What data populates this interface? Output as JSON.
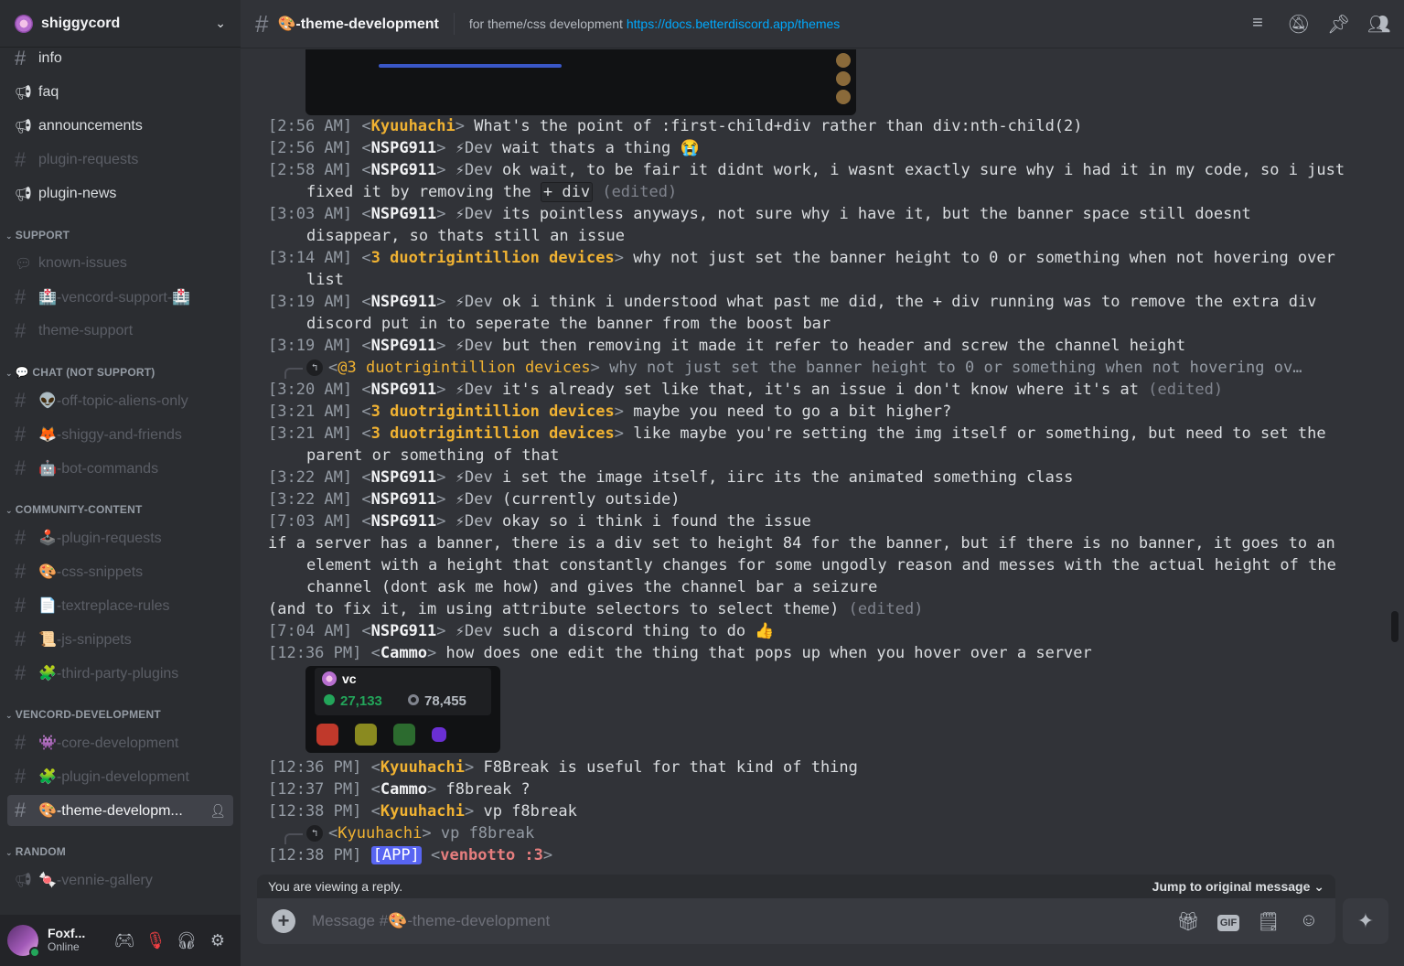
{
  "server": {
    "name": "shiggycord"
  },
  "channel_groups": {
    "top": [
      {
        "label": "info",
        "icon": "hash",
        "style": "bright"
      },
      {
        "label": "faq",
        "icon": "megaphone",
        "style": "bright"
      },
      {
        "label": "announcements",
        "icon": "megaphone",
        "style": "bright"
      },
      {
        "label": "plugin-requests",
        "icon": "hash",
        "style": "muted"
      },
      {
        "label": "plugin-news",
        "icon": "megaphone",
        "style": "bright"
      }
    ],
    "support_label": "SUPPORT",
    "support": [
      {
        "label": "known-issues",
        "icon": "forum",
        "style": "muted"
      },
      {
        "label": "🏥-vencord-support-🏥",
        "icon": "hash",
        "style": "muted"
      },
      {
        "label": "theme-support",
        "icon": "hash",
        "style": "muted"
      }
    ],
    "chat_label": "💬 CHAT (NOT SUPPORT)",
    "chat": [
      {
        "label": "👽-off-topic-aliens-only",
        "icon": "hash",
        "style": "muted"
      },
      {
        "label": "🦊-shiggy-and-friends",
        "icon": "hash",
        "style": "muted"
      },
      {
        "label": "🤖-bot-commands",
        "icon": "hash",
        "style": "muted"
      }
    ],
    "community_label": "COMMUNITY-CONTENT",
    "community": [
      {
        "label": "🕹️-plugin-requests",
        "icon": "hash",
        "style": "muted"
      },
      {
        "label": "🎨-css-snippets",
        "icon": "hash",
        "style": "muted"
      },
      {
        "label": "📄-textreplace-rules",
        "icon": "hash",
        "style": "muted"
      },
      {
        "label": "📜-js-snippets",
        "icon": "hash",
        "style": "muted"
      },
      {
        "label": "🧩-third-party-plugins",
        "icon": "hash",
        "style": "muted"
      }
    ],
    "vencord_label": "VENCORD-DEVELOPMENT",
    "vencord": [
      {
        "label": "👾-core-development",
        "icon": "hash",
        "style": "muted"
      },
      {
        "label": "🧩-plugin-development",
        "icon": "hash",
        "style": "muted"
      },
      {
        "label": "🎨-theme-developm...",
        "icon": "hash",
        "style": "active"
      }
    ],
    "random_label": "RANDOM",
    "random": [
      {
        "label": "🍬-vennie-gallery",
        "icon": "megaphone",
        "style": "muted"
      }
    ]
  },
  "user": {
    "name": "Foxf...",
    "status": "Online"
  },
  "header": {
    "channel": "🎨-theme-development",
    "topic": "for theme/css development",
    "topic_link": "https://docs.betterdiscord.app/themes"
  },
  "messages": [
    {
      "ts": "[2:56 AM]",
      "author": "Kyuuhachi",
      "color": "gold",
      "tag": "",
      "text": "What's the point of :first-child+div rather than div:nth-child(2)"
    },
    {
      "ts": "[2:56 AM]",
      "author": "NSPG911",
      "color": "white",
      "tag": "⚡Dev",
      "text": "wait thats a thing 😭"
    },
    {
      "ts": "[2:58 AM]",
      "author": "NSPG911",
      "color": "white",
      "tag": "⚡Dev",
      "text": "ok wait, to be fair it didnt work, i wasnt exactly sure why i had it in my code, so i just fixed it by removing the",
      "code": "+ div",
      "edited": "(edited)"
    },
    {
      "ts": "[3:03 AM]",
      "author": "NSPG911",
      "color": "white",
      "tag": "⚡Dev",
      "text": "its pointless anyways, not sure why i have it, but the banner space still doesnt disappear, so thats still an issue"
    },
    {
      "ts": "[3:14 AM]",
      "author": "3 duotrigintillion devices",
      "color": "gold",
      "tag": "",
      "text": "why not just set the banner height to 0 or something when not hovering over list"
    },
    {
      "ts": "[3:19 AM]",
      "author": "NSPG911",
      "color": "white",
      "tag": "⚡Dev",
      "text": "ok i think i understood what past me did, the + div running was to remove the extra div discord put in to seperate the banner from the boost bar"
    },
    {
      "ts": "[3:19 AM]",
      "author": "NSPG911",
      "color": "white",
      "tag": "⚡Dev",
      "text": "but then removing it made it refer to header and screw the channel height"
    },
    {
      "reply_author": "@3 duotrigintillion devices",
      "reply_text": "why not just set the banner height to 0 or something when not hovering ov…",
      "ts": "[3:20 AM]",
      "author": "NSPG911",
      "color": "white",
      "tag": "⚡Dev",
      "text": "it's already set like that, it's an issue i don't know where it's at",
      "edited": "(edited)"
    },
    {
      "ts": "[3:21 AM]",
      "author": "3 duotrigintillion devices",
      "color": "gold",
      "tag": "",
      "text": "maybe you need to go a bit higher?"
    },
    {
      "ts": "[3:21 AM]",
      "author": "3 duotrigintillion devices",
      "color": "gold",
      "tag": "",
      "text": "like maybe you're setting the img itself or something, but need to set the parent or something of that"
    },
    {
      "ts": "[3:22 AM]",
      "author": "NSPG911",
      "color": "white",
      "tag": "⚡Dev",
      "text": "i set the image itself, iirc its the animated something class"
    },
    {
      "ts": "[3:22 AM]",
      "author": "NSPG911",
      "color": "white",
      "tag": "⚡Dev",
      "text": "(currently outside)"
    },
    {
      "ts": "[7:03 AM]",
      "author": "NSPG911",
      "color": "white",
      "tag": "⚡Dev",
      "text": "okay so i think i found the issue"
    },
    {
      "cont": "if a server has a banner, there is a div set to height 84 for the banner, but if there is no banner, it goes to an element with a height that constantly changes for some ungodly reason and messes with the actual height of the channel (dont ask me how) and gives the channel bar a seizure"
    },
    {
      "cont": "(and to fix it, im using attribute selectors to select theme)",
      "edited": "(edited)"
    },
    {
      "ts": "[7:04 AM]",
      "author": "NSPG911",
      "color": "white",
      "tag": "⚡Dev",
      "text": "such a discord thing to do 👍"
    },
    {
      "ts": "[12:36 PM]",
      "author": "Cammo",
      "color": "white",
      "tag": "",
      "text": "how does one edit the thing that pops up when you hover over a server"
    }
  ],
  "attachment_tooltip": {
    "name": "vc",
    "online": "27,133",
    "total": "78,455"
  },
  "messages2": [
    {
      "ts": "[12:36 PM]",
      "author": "Kyuuhachi",
      "color": "gold",
      "tag": "",
      "text": "F8Break is useful for that kind of thing"
    },
    {
      "ts": "[12:37 PM]",
      "author": "Cammo",
      "color": "white",
      "tag": "",
      "text": "f8break ?"
    },
    {
      "ts": "[12:38 PM]",
      "author": "Kyuuhachi",
      "color": "gold",
      "tag": "",
      "text": "vp f8break"
    },
    {
      "reply_author": "Kyuuhachi",
      "reply_text": "vp f8break",
      "ts": "[12:38 PM]",
      "app": "[APP]",
      "author": "venbotto :3",
      "color": "red",
      "tag": "",
      "text": ""
    }
  ],
  "reply_bar": {
    "viewing": "You are viewing a reply.",
    "jump": "Jump to original message"
  },
  "composer": {
    "placeholder": "Message #🎨-theme-development",
    "gif": "GIF"
  }
}
